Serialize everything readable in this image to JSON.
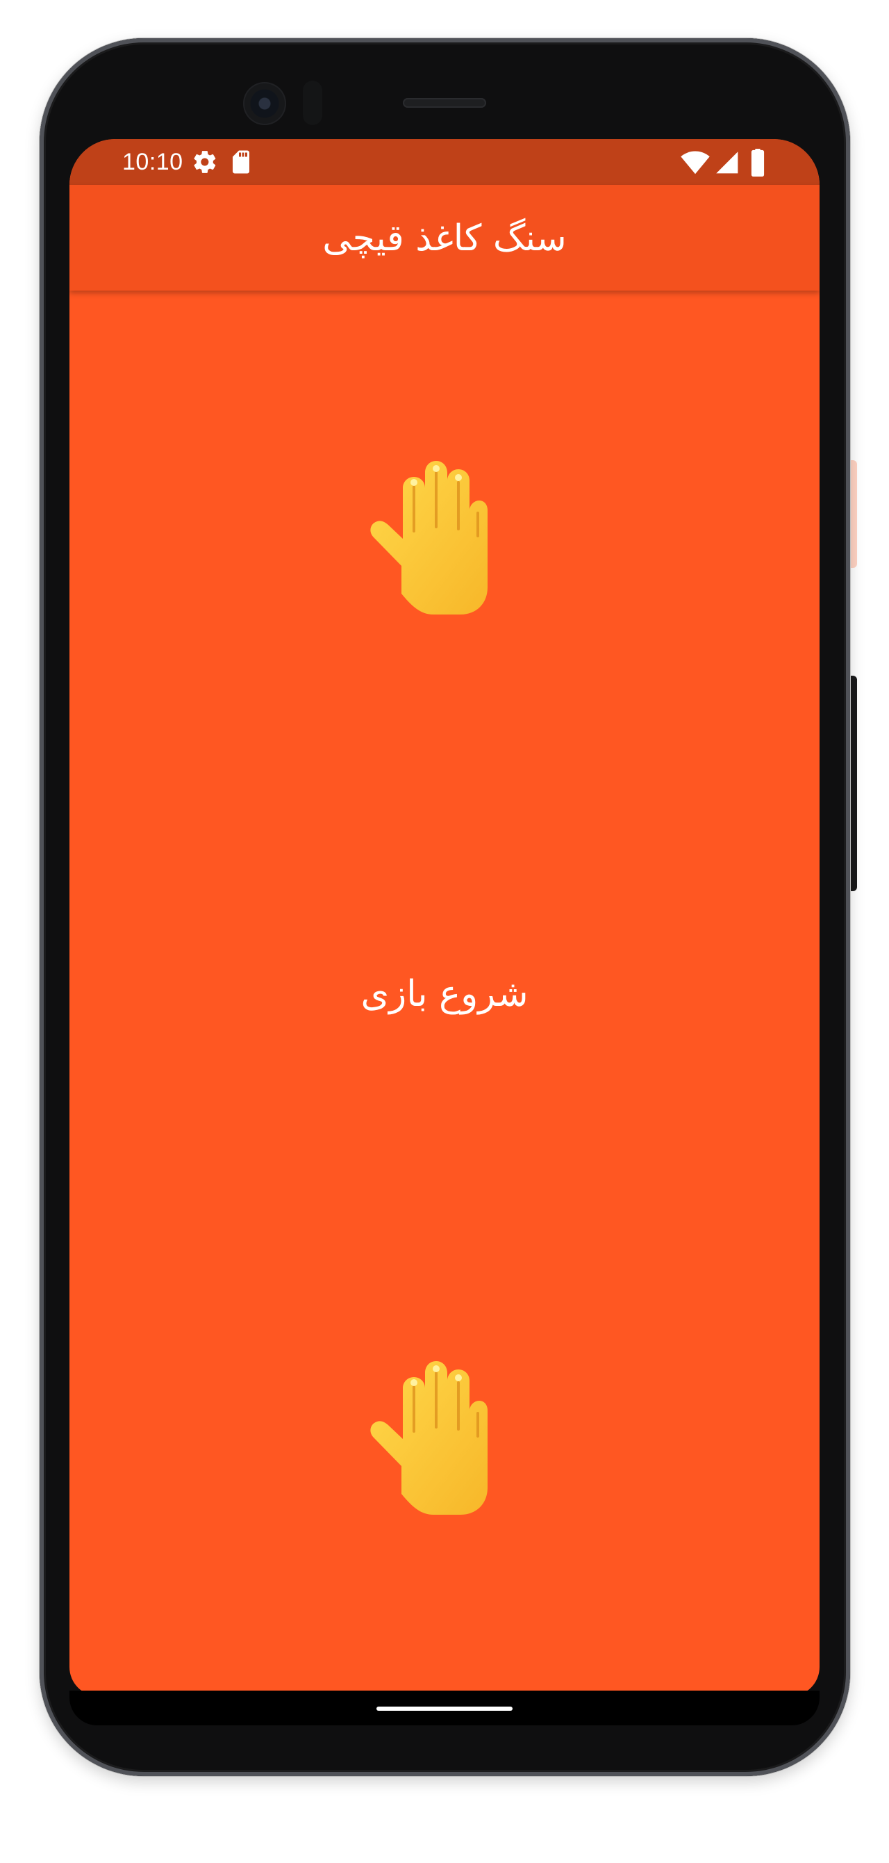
{
  "status_bar": {
    "time": "10:10",
    "icons": [
      "gear-icon",
      "sd-card-icon",
      "wifi-icon",
      "signal-icon",
      "battery-icon"
    ]
  },
  "toolbar": {
    "title": "سنگ  کاغذ  قیچی"
  },
  "game": {
    "opponent_choice_icon": "raised-hand-icon",
    "player_choice_icon": "raised-hand-icon",
    "start_label": "شروع بازی"
  },
  "colors": {
    "screen_background": "#ff5722",
    "toolbar": "#f4511e",
    "status_bar": "#bf4118",
    "text": "#ffffff"
  }
}
